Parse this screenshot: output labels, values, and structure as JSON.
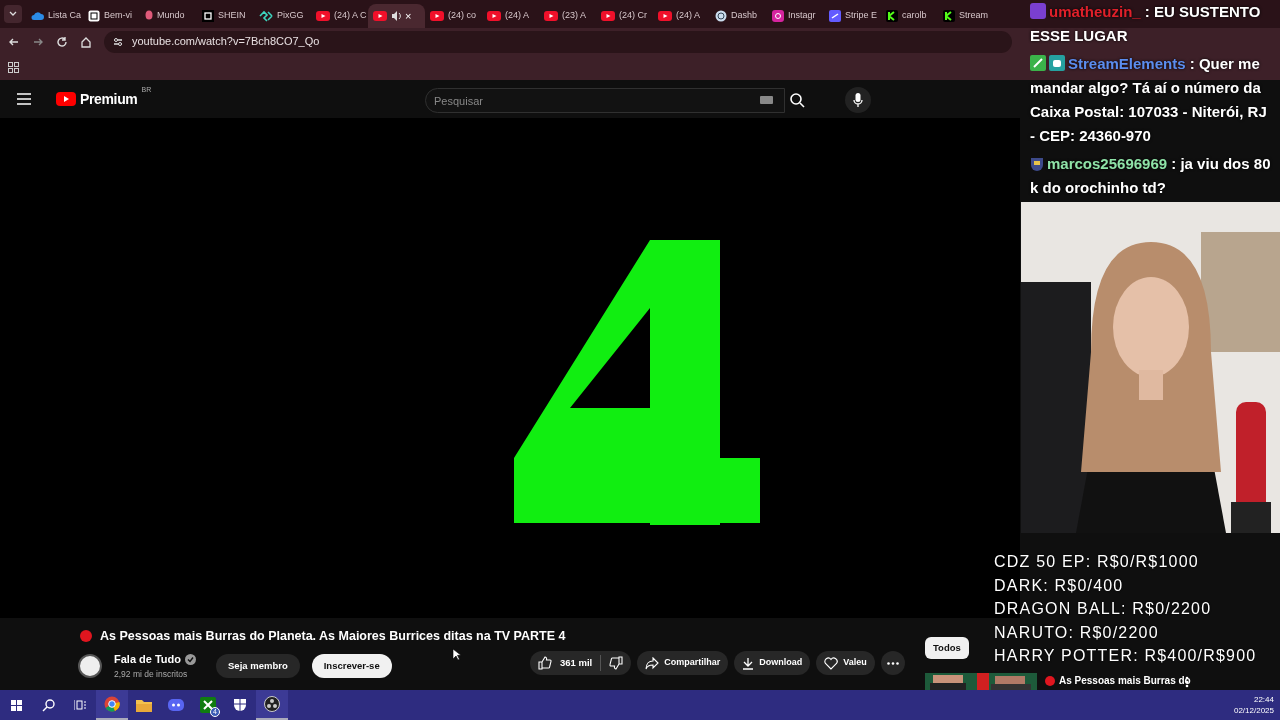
{
  "browser": {
    "tabs": [
      {
        "label": "Lista Ca",
        "kind": "cloud",
        "selected": false
      },
      {
        "label": "Bem-vi",
        "kind": "notion",
        "selected": false
      },
      {
        "label": "Mundo",
        "kind": "pin",
        "selected": false
      },
      {
        "label": "SHEIN",
        "kind": "square",
        "selected": false
      },
      {
        "label": "PixGG",
        "kind": "pix",
        "selected": false
      },
      {
        "label": "(24) A C",
        "kind": "youtube",
        "selected": false
      },
      {
        "kind": "youtube",
        "selected": true,
        "audio": true,
        "close": "×"
      },
      {
        "label": "(24) co",
        "kind": "youtube",
        "selected": false
      },
      {
        "label": "(24) A",
        "kind": "youtube",
        "selected": false
      },
      {
        "label": "(23) A",
        "kind": "youtube",
        "selected": false
      },
      {
        "label": "(24) Cr",
        "kind": "youtube",
        "selected": false
      },
      {
        "label": "(24) A",
        "kind": "youtube",
        "selected": false
      },
      {
        "label": "Dashb",
        "kind": "globe",
        "selected": false
      },
      {
        "label": "Instagr",
        "kind": "instagram",
        "selected": false
      },
      {
        "label": "Stripe E",
        "kind": "stripe",
        "selected": false
      },
      {
        "label": "carolb",
        "kind": "kick",
        "selected": false
      },
      {
        "label": "Stream",
        "kind": "kick",
        "selected": false
      }
    ],
    "address": "youtube.com/watch?v=7Bch8CO7_Qo"
  },
  "youtube": {
    "logo": "Premium",
    "region": "BR",
    "search_placeholder": "Pesquisar",
    "video_title": "As Pessoas mais Burras do Planeta. As Maiores Burrices ditas na TV PARTE 4",
    "channel": "Fala de Tudo",
    "subscribers": "2,92 mi de inscritos",
    "member_button": "Seja membro",
    "subscribe_button": "Inscrever-se",
    "likes": "361 mil",
    "actions": [
      {
        "kind": "share",
        "label": "Compartilhar"
      },
      {
        "kind": "download",
        "label": "Download"
      },
      {
        "kind": "thanks",
        "label": "Valeu"
      }
    ],
    "chips": [
      {
        "label": "Todos",
        "selected": true
      }
    ],
    "recommendation": {
      "title": "As Pessoas mais Burras do"
    }
  },
  "chat": [
    {
      "user": "umatheuzin_",
      "color": "#e0202a",
      "text": ": EU SUSTENTO ESSE LUGAR"
    },
    {
      "user": "StreamElements",
      "color": "#5b8def",
      "text": ": Quer me mandar algo? Tá aí o número da Caixa Postal: 107033 - Niterói, RJ - CEP: 24360-970"
    },
    {
      "user": "marcos25696969",
      "color": "#8fe3a8",
      "text": ": ja viu dos 80 k do orochinho td?"
    }
  ],
  "goals": [
    "CDZ 50 EP: R$0/R$1000",
    "DARK: R$0/400",
    "DRAGON BALL: R$0/2200",
    "NARUTO: R$0/2200",
    "HARRY POTTER: R$400/R$900"
  ],
  "taskbar": {
    "apps": [
      {
        "kind": "chrome",
        "selected": true
      },
      {
        "kind": "folder",
        "selected": false
      },
      {
        "kind": "discord",
        "selected": false
      },
      {
        "kind": "xbox",
        "selected": false,
        "badge": "4"
      },
      {
        "kind": "shield",
        "selected": false
      },
      {
        "kind": "obs",
        "selected": true
      }
    ],
    "time": "22:44",
    "date": "02/12/2025"
  }
}
